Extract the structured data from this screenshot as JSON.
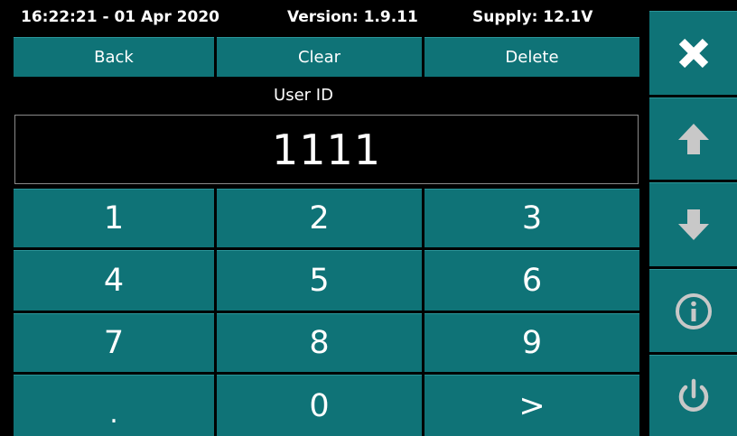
{
  "status": {
    "datetime": "16:22:21 - 01 Apr 2020",
    "version": "Version: 1.9.11",
    "supply": "Supply: 12.1V"
  },
  "toolbar": {
    "back_label": "Back",
    "clear_label": "Clear",
    "delete_label": "Delete"
  },
  "entry": {
    "label": "User ID",
    "value": "1111"
  },
  "keypad": {
    "keys": [
      "1",
      "2",
      "3",
      "4",
      "5",
      "6",
      "7",
      "8",
      "9",
      ".",
      "0",
      ">"
    ]
  },
  "sidebar": {
    "icons": [
      "close-icon",
      "arrow-up-icon",
      "arrow-down-icon",
      "info-icon",
      "power-icon"
    ]
  },
  "colors": {
    "button": "#0f7377",
    "background": "#000000",
    "text": "#ffffff",
    "icon_muted": "#c8c8c8"
  }
}
